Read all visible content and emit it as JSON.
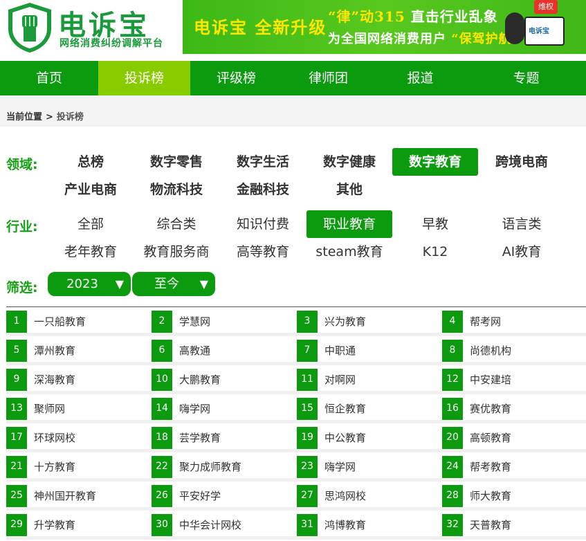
{
  "header": {
    "logo_title": "电诉宝",
    "logo_subtitle": "网络消费纠纷调解平台",
    "banner_left": "电诉宝 全新升级",
    "banner_line1_a": "“律”动315",
    "banner_line1_b": "直击行业乱象",
    "banner_line2_a": "为全国网络消费用户",
    "banner_line2_b": "“保驾护航”",
    "banner_badge": "维权",
    "banner_device": "电诉宝"
  },
  "nav": {
    "items": [
      "首页",
      "投诉榜",
      "评级榜",
      "律师团",
      "报道",
      "专题"
    ],
    "active_index": 1
  },
  "breadcrumb": {
    "prefix": "当前位置",
    "separator": ">",
    "current": "投诉榜"
  },
  "domain_filter": {
    "label": "领域:",
    "options": [
      "总榜",
      "数字零售",
      "数字生活",
      "数字健康",
      "数字教育",
      "跨境电商",
      "产业电商",
      "物流科技",
      "金融科技",
      "其他"
    ],
    "active_index": 4
  },
  "industry_filter": {
    "label": "行业:",
    "options": [
      "全部",
      "综合类",
      "知识付费",
      "职业教育",
      "早教",
      "语言类",
      "老年教育",
      "教育服务商",
      "高等教育",
      "steam教育",
      "K12",
      "AI教育"
    ],
    "active_index": 3
  },
  "screen_filter": {
    "label": "筛选:",
    "year": "2023",
    "range": "至今",
    "arrow": "▼"
  },
  "ranking": [
    {
      "rank": "1",
      "name": "一只船教育"
    },
    {
      "rank": "2",
      "name": "学慧网"
    },
    {
      "rank": "3",
      "name": "兴为教育"
    },
    {
      "rank": "4",
      "name": "帮考网"
    },
    {
      "rank": "5",
      "name": "潭州教育"
    },
    {
      "rank": "6",
      "name": "高教通"
    },
    {
      "rank": "7",
      "name": "中职通"
    },
    {
      "rank": "8",
      "name": "尚德机构"
    },
    {
      "rank": "9",
      "name": "深海教育"
    },
    {
      "rank": "10",
      "name": "大鹏教育"
    },
    {
      "rank": "11",
      "name": "对啊网"
    },
    {
      "rank": "12",
      "name": "中安建培"
    },
    {
      "rank": "13",
      "name": "聚师网"
    },
    {
      "rank": "14",
      "name": "嗨学网"
    },
    {
      "rank": "15",
      "name": "恒企教育"
    },
    {
      "rank": "16",
      "name": "赛优教育"
    },
    {
      "rank": "17",
      "name": "环球网校"
    },
    {
      "rank": "18",
      "name": "芸学教育"
    },
    {
      "rank": "19",
      "name": "中公教育"
    },
    {
      "rank": "20",
      "name": "高顿教育"
    },
    {
      "rank": "21",
      "name": "十方教育"
    },
    {
      "rank": "22",
      "name": "聚力成师教育"
    },
    {
      "rank": "23",
      "name": "嗨学网"
    },
    {
      "rank": "24",
      "name": "帮考教育"
    },
    {
      "rank": "25",
      "name": "神州国开教育"
    },
    {
      "rank": "26",
      "name": "平安好学"
    },
    {
      "rank": "27",
      "name": "思鸿网校"
    },
    {
      "rank": "28",
      "name": "师大教育"
    },
    {
      "rank": "29",
      "name": "升学教育"
    },
    {
      "rank": "30",
      "name": "中华会计网校"
    },
    {
      "rank": "31",
      "name": "鸿博教育"
    },
    {
      "rank": "32",
      "name": "天普教育"
    }
  ],
  "colors": {
    "brand_green": "#0c9a0f",
    "nav_active": "#88cc00",
    "label_green": "#14a114"
  }
}
